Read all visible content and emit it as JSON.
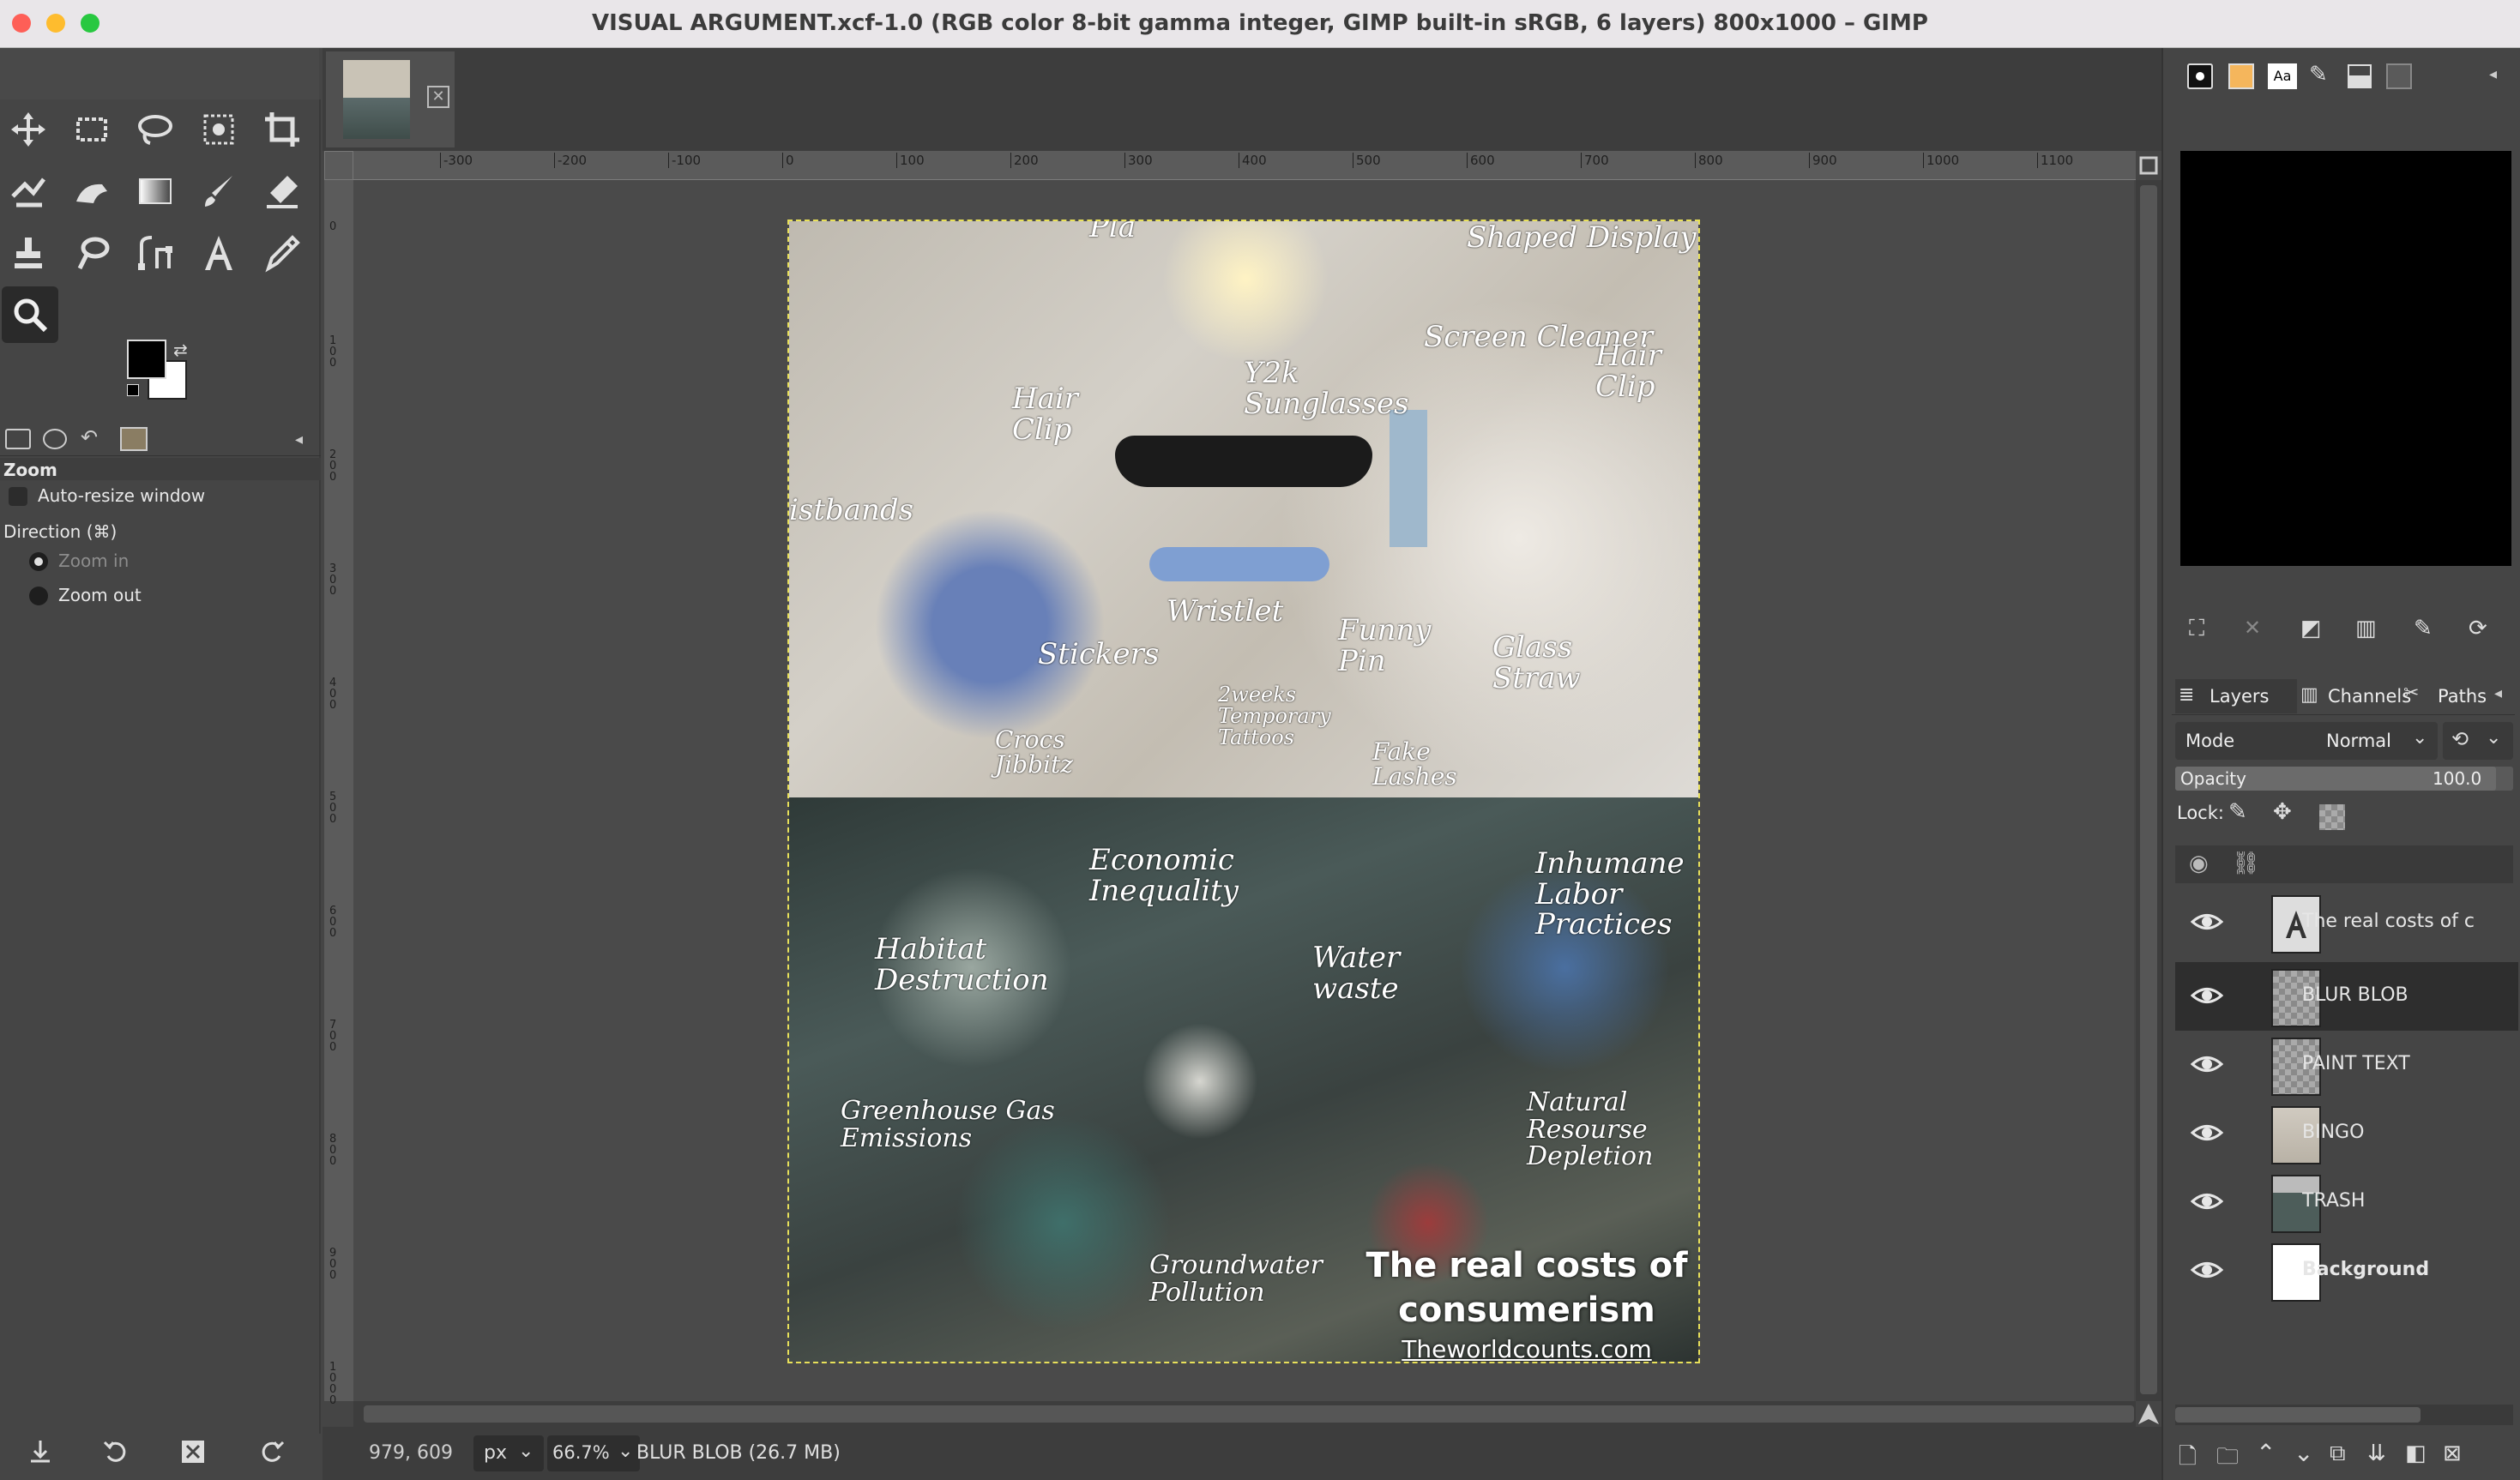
{
  "window": {
    "title": "VISUAL ARGUMENT.xcf-1.0 (RGB color 8-bit gamma integer, GIMP built-in sRGB, 6 layers) 800x1000 – GIMP"
  },
  "toolbox": {
    "tools": [
      "move-tool",
      "rect-select-tool",
      "free-select-tool",
      "fuzzy-select-tool",
      "crop-tool",
      "warp-transform-tool",
      "smudge-tool",
      "gradient-tool",
      "paintbrush-tool",
      "eraser-tool",
      "clone-tool",
      "heal-tool",
      "paths-tool",
      "text-tool",
      "color-picker-tool",
      "zoom-tool"
    ],
    "fg_color": "#000000",
    "bg_color": "#ffffff"
  },
  "tool_options": {
    "title": "Zoom",
    "auto_resize_label": "Auto-resize window",
    "direction_label": "Direction  (⌘)",
    "zoom_in_label": "Zoom in",
    "zoom_out_label": "Zoom out",
    "selected_direction": "Zoom out"
  },
  "rulers": {
    "h_labels": [
      "-300",
      "-200",
      "-100",
      "0",
      "100",
      "200",
      "300",
      "400",
      "500",
      "600",
      "700",
      "800",
      "900",
      "1000",
      "1100"
    ],
    "v_labels": [
      "0",
      "100",
      "200",
      "300",
      "400",
      "500",
      "600",
      "700",
      "800",
      "900",
      "1000"
    ]
  },
  "image": {
    "top_annotations": [
      "Shaped Display",
      "Screen Cleaner",
      "Hair Clip",
      "Y2k Sunglasses",
      "Hair Clip",
      "istbands",
      "Wristlet",
      "Stickers",
      "Funny Pin",
      "Glass Straw",
      "2weeks Temporary Tattoos",
      "Crocs Jibbitz",
      "Fake Lashes",
      "Pla"
    ],
    "bottom_annotations": [
      "Economic Inequality",
      "Inhumane Labor Practices",
      "Habitat Destruction",
      "Water waste",
      "Greenhouse Gas Emissions",
      "Natural Resourse Depletion",
      "Groundwater Pollution"
    ],
    "caption_line1": "The real costs of",
    "caption_line2": "consumerism",
    "caption_link": "Theworldcounts.com"
  },
  "statusbar": {
    "coords": "979, 609",
    "unit": "px",
    "zoom": "66.7%",
    "info": "BLUR BLOB (26.7 MB)"
  },
  "layers_panel": {
    "tabs": [
      "Layers",
      "Channels",
      "Paths"
    ],
    "mode_label": "Mode",
    "mode_value": "Normal",
    "opacity_label": "Opacity",
    "opacity_value": "100.0",
    "lock_label": "Lock:",
    "layers": [
      {
        "name": "The real costs of c",
        "thumb": "text",
        "bold": false
      },
      {
        "name": "BLUR BLOB",
        "thumb": "checker",
        "bold": false,
        "selected": true
      },
      {
        "name": "PAINT TEXT",
        "thumb": "checker",
        "bold": false
      },
      {
        "name": "BINGO",
        "thumb": "photo",
        "bold": false
      },
      {
        "name": "TRASH",
        "thumb": "trash",
        "bold": false
      },
      {
        "name": "Background",
        "thumb": "white",
        "bold": true
      }
    ]
  },
  "colors": {
    "panel_bg": "#454545",
    "dark_bg": "#3d3d3d",
    "selected_layer": "#2e2e2e"
  }
}
